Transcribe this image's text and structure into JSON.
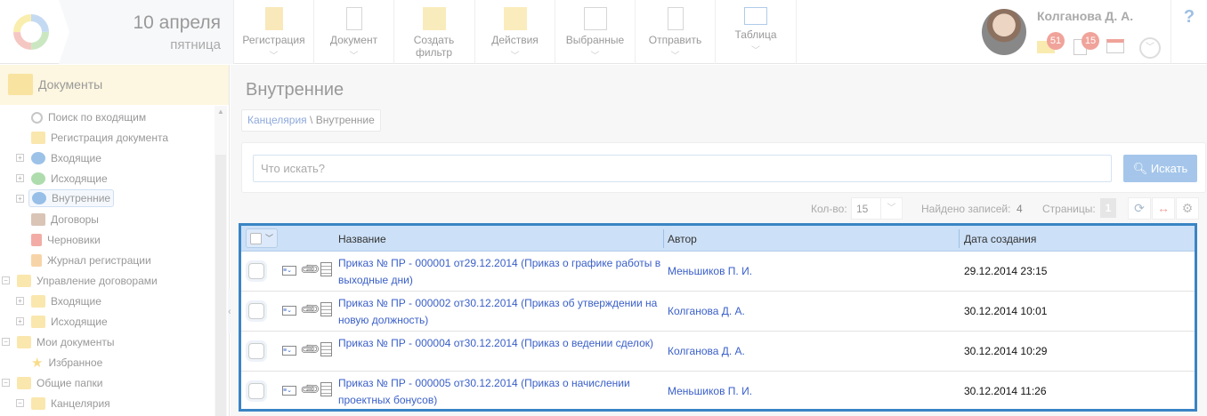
{
  "header": {
    "date": "10 апреля",
    "weekday": "пятница",
    "toolbar": [
      {
        "label": "Регистрация",
        "icon": "registration-icon"
      },
      {
        "label": "Документ",
        "icon": "new-document-icon"
      },
      {
        "label": "Создать фильтр",
        "icon": "create-filter-icon"
      },
      {
        "label": "Действия",
        "icon": "actions-folder-icon"
      },
      {
        "label": "Выбранные",
        "icon": "selected-icon"
      },
      {
        "label": "Отправить",
        "icon": "send-icon"
      },
      {
        "label": "Таблица",
        "icon": "table-icon"
      }
    ],
    "user": {
      "name": "Колганова Д. А.",
      "mail_count": "51",
      "tasks_count": "15"
    },
    "help": "?"
  },
  "sidebar": {
    "title": "Документы",
    "items": [
      {
        "label": "Поиск по входящим"
      },
      {
        "label": "Регистрация документа"
      },
      {
        "label": "Входящие"
      },
      {
        "label": "Исходящие"
      },
      {
        "label": "Внутренние"
      },
      {
        "label": "Договоры"
      },
      {
        "label": "Черновики"
      },
      {
        "label": "Журнал регистрации"
      },
      {
        "label": "Управление договорами"
      },
      {
        "label": "Входящие"
      },
      {
        "label": "Исходящие"
      },
      {
        "label": "Мои документы"
      },
      {
        "label": "Избранное"
      },
      {
        "label": "Общие папки"
      },
      {
        "label": "Канцелярия"
      }
    ]
  },
  "main": {
    "title": "Внутренние",
    "breadcrumb": {
      "parent": "Канцелярия",
      "sep": " \\ ",
      "current": "Внутренние"
    },
    "search": {
      "placeholder": "Что искать?",
      "button": "Искать"
    },
    "toolbar": {
      "qty_label": "Кол-во:",
      "qty_value": "15",
      "found_label": "Найдено записей:",
      "found_value": "4",
      "pages_label": "Страницы:",
      "page": "1"
    },
    "table": {
      "columns": [
        "Название",
        "Автор",
        "Дата создания"
      ],
      "rows": [
        {
          "title": "Приказ № ПР - 000001 от29.12.2014 (Приказ о графике работы в выходные дни)",
          "author": "Меньшиков П. И.",
          "date": "29.12.2014 23:15"
        },
        {
          "title": "Приказ № ПР - 000002 от30.12.2014 (Приказ об утверждении на новую должность)",
          "author": "Колганова Д. А.",
          "date": "30.12.2014 10:01"
        },
        {
          "title": "Приказ № ПР - 000004 от30.12.2014 (Приказ о ведении сделок)",
          "author": "Колганова Д. А.",
          "date": "30.12.2014 10:29"
        },
        {
          "title": "Приказ № ПР - 000005 от30.12.2014 (Приказ о начислении проектных бонусов)",
          "author": "Меньшиков П. И.",
          "date": "30.12.2014 11:26"
        }
      ]
    }
  }
}
